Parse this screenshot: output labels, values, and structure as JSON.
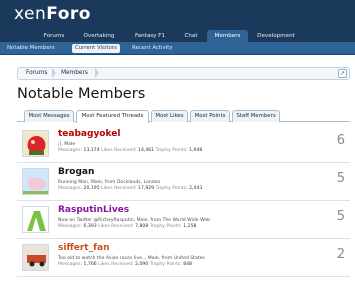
{
  "brand": {
    "logo_a": "xen",
    "logo_b": "F",
    "logo_c": "o",
    "logo_d": "r",
    "logo_e": "o"
  },
  "nav": {
    "tabs": [
      {
        "label": "Forums",
        "selected": false
      },
      {
        "label": "Overtaking",
        "selected": false
      },
      {
        "label": "Fantasy F1",
        "selected": false
      },
      {
        "label": "Chat",
        "selected": false
      },
      {
        "label": "Members",
        "selected": true
      },
      {
        "label": "Development",
        "selected": false
      }
    ]
  },
  "subnav": {
    "items": [
      {
        "label": "Notable Members",
        "selected": false
      },
      {
        "label": "Current Visitors",
        "selected": true
      },
      {
        "label": "Recent Activity",
        "selected": false
      }
    ]
  },
  "breadcrumb": {
    "items": [
      "Forums",
      "Members"
    ]
  },
  "page": {
    "title": "Notable Members"
  },
  "tabs": [
    {
      "label": "Most Messages",
      "selected": false
    },
    {
      "label": "Most Featured Threads",
      "selected": true
    },
    {
      "label": "Most Likes",
      "selected": false
    },
    {
      "label": "Most Points",
      "selected": false
    },
    {
      "label": "Staff Members",
      "selected": false
    }
  ],
  "stat_labels": {
    "messages": "Messages:",
    "likes": "Likes Received:",
    "points": "Trophy Points:"
  },
  "members": [
    {
      "name": "teabagyokel",
      "name_color": "#b40000",
      "info": ";), Male",
      "messages": "13,174",
      "likes": "14,461",
      "points": "1,948",
      "count": "6"
    },
    {
      "name": "Brogan",
      "name_color": "#141414",
      "info": "Running Man, Male, from Docklands, London",
      "messages": "20,195",
      "likes": "17,929",
      "points": "2,443",
      "count": "5"
    },
    {
      "name": "RasputinLives",
      "name_color": "#8a14a0",
      "info": "Now on Twitter @RicheyRasputin, Male, from The World Wide Web",
      "messages": "6,393",
      "likes": "7,808",
      "points": "1,258",
      "count": "5"
    },
    {
      "name": "siffert_fan",
      "name_color": "#c8501e",
      "info": "Too old to watch the Asian races live.., Male, from United States",
      "messages": "1,766",
      "likes": "2,090",
      "points": "848",
      "count": "2"
    }
  ],
  "icons": {
    "jump": "jump-to-icon"
  },
  "colors": {
    "header": "#1b3a5b",
    "subnav": "#2e6395",
    "accent": "#2e6395"
  }
}
